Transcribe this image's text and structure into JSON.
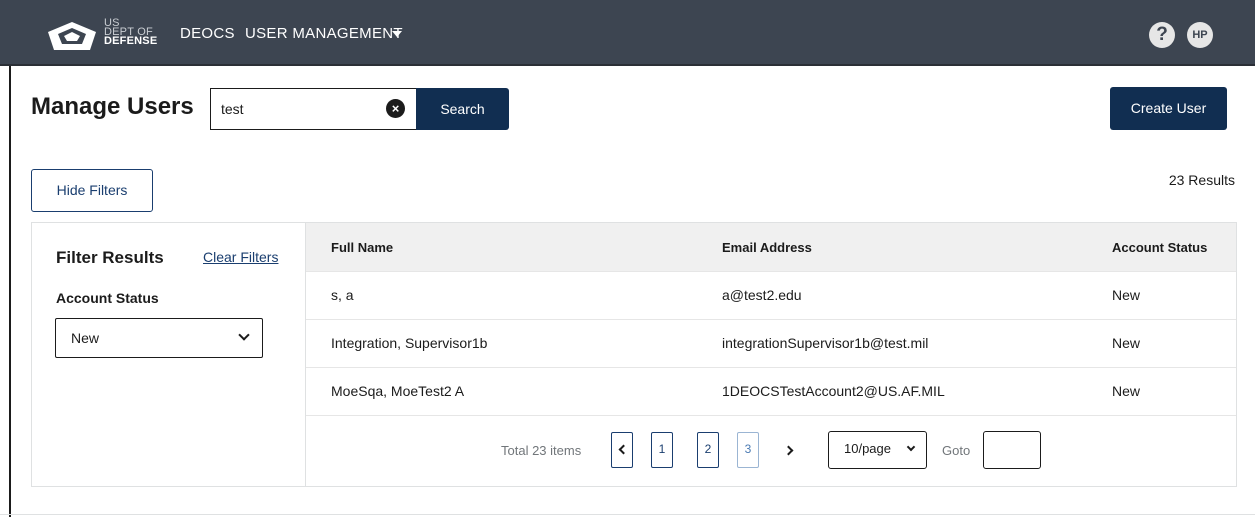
{
  "nav": {
    "logo_lines": [
      "US",
      "DEPT OF"
    ],
    "logo_bold": "DEFENSE",
    "app_name": "DEOCS",
    "menu_label": "USER MANAGEMENT",
    "help_glyph": "?",
    "avatar_initials": "HP"
  },
  "header": {
    "title": "Manage Users",
    "search_value": "test",
    "search_button": "Search",
    "create_button": "Create User"
  },
  "toolbar": {
    "hide_filters": "Hide Filters",
    "results_count": "23 Results"
  },
  "filters": {
    "title": "Filter Results",
    "clear_label": "Clear Filters",
    "account_status_label": "Account Status",
    "account_status_value": "New"
  },
  "table": {
    "columns": [
      "Full Name",
      "Email Address",
      "Account Status"
    ],
    "rows": [
      {
        "name": "s, a",
        "email": "a@test2.edu",
        "status": "New"
      },
      {
        "name": "Integration, Supervisor1b",
        "email": "integrationSupervisor1b@test.mil",
        "status": "New"
      },
      {
        "name": "MoeSqa, MoeTest2 A",
        "email": "1DEOCSTestAccount2@US.AF.MIL",
        "status": "New"
      }
    ]
  },
  "pagination": {
    "total_label": "Total 23 items",
    "pages": [
      "1",
      "2",
      "3"
    ],
    "current_page": "3",
    "page_size": "10/page",
    "goto_label": "Goto",
    "goto_value": ""
  },
  "colors": {
    "nav_bg": "#3d4551",
    "primary": "#112e51",
    "link": "#1a3e6f"
  },
  "icons": {
    "clear_search": "close-circle-icon",
    "dropdown": "chevron-down-icon",
    "prev": "chevron-left-icon",
    "next": "chevron-right-icon"
  }
}
